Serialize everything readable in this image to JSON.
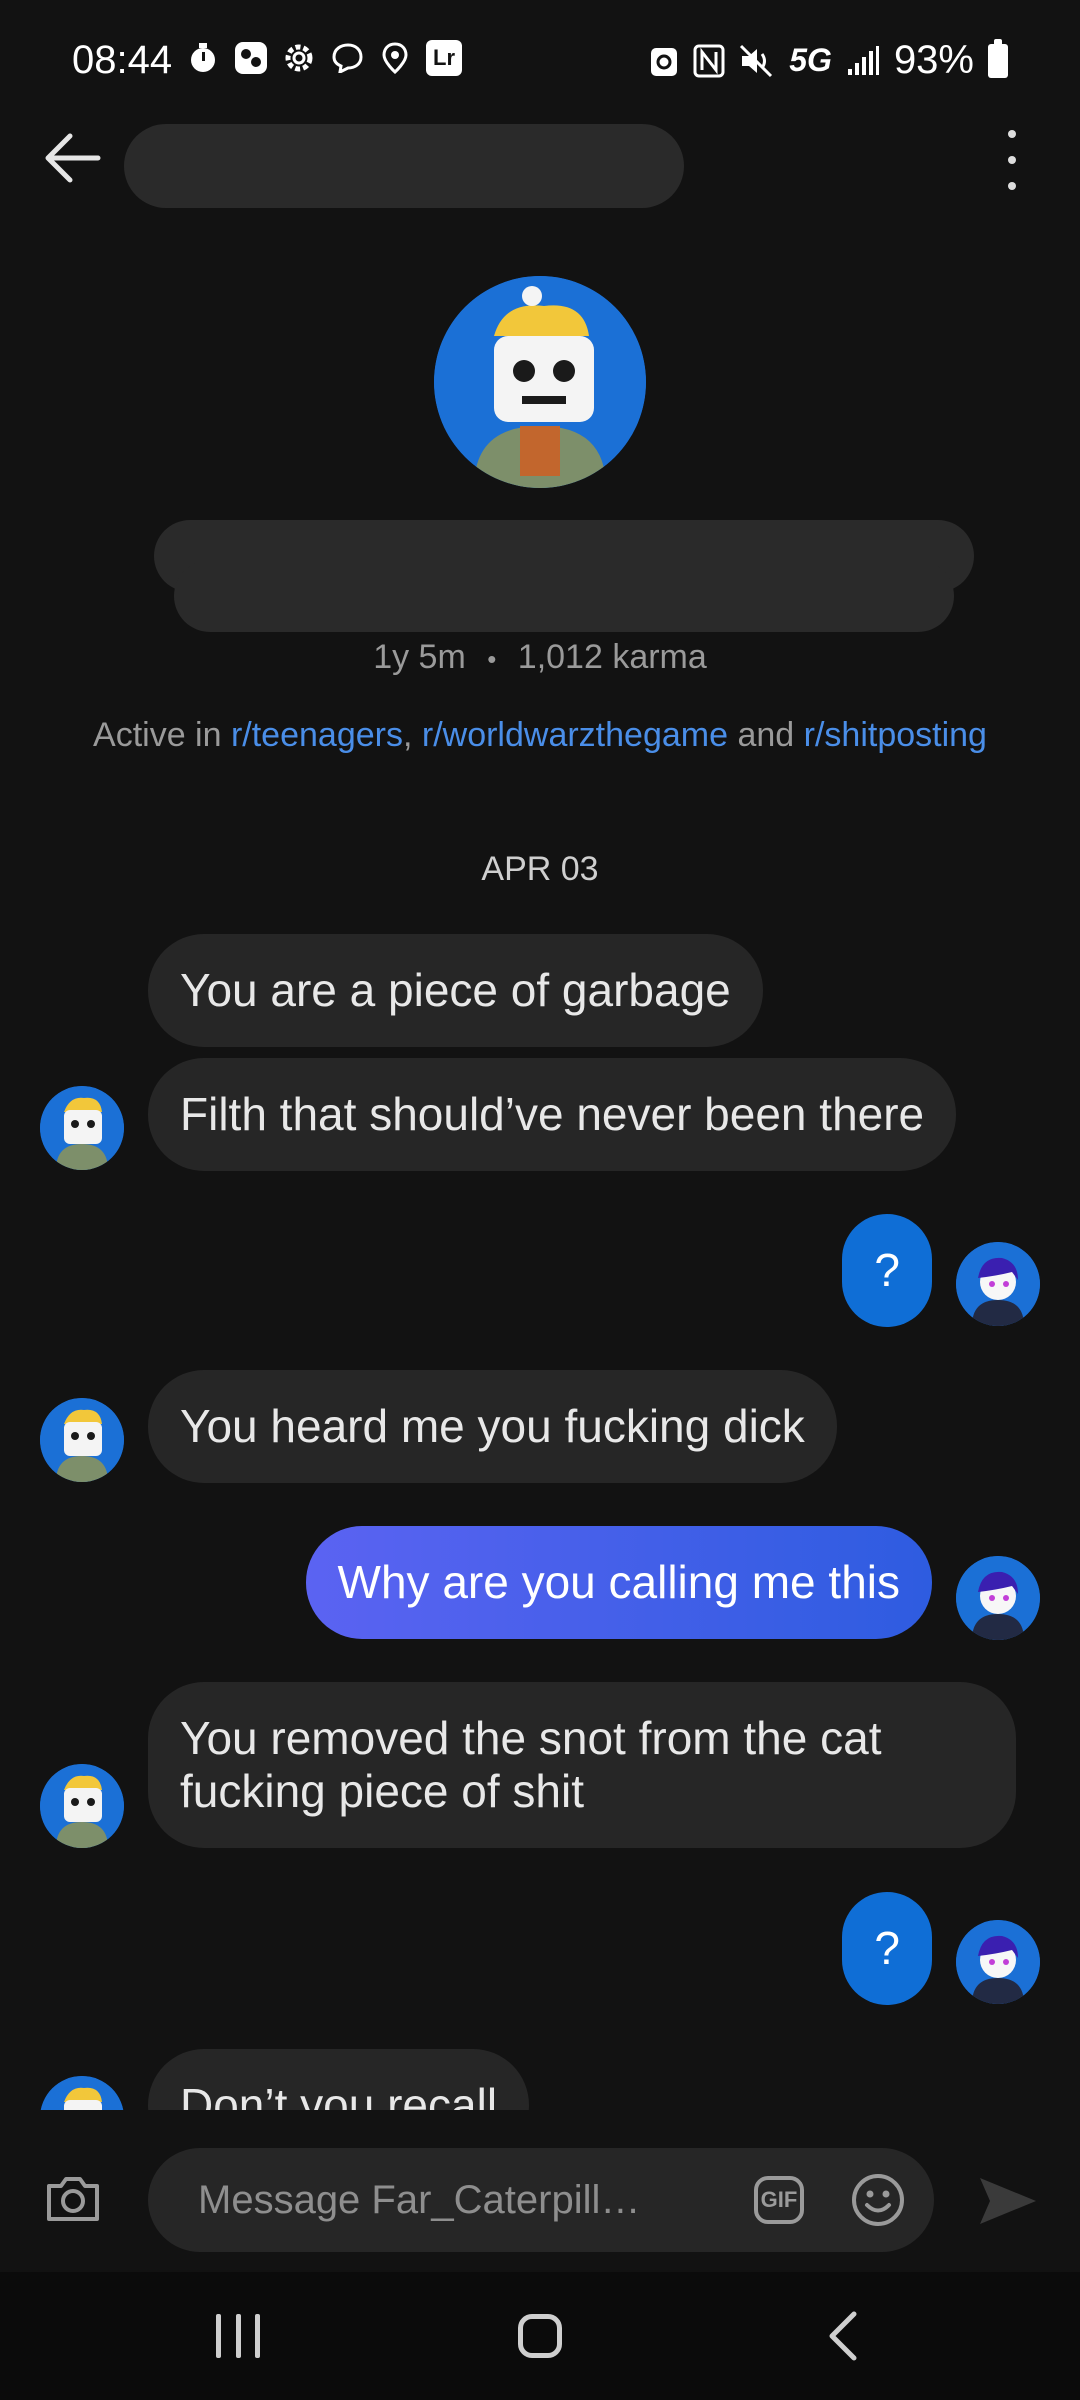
{
  "status_bar": {
    "time": "08:44",
    "network": "5G",
    "battery": "93%",
    "left_icons": [
      "timer-icon",
      "app-icon",
      "settings-icon",
      "messenger-icon",
      "location-icon",
      "lightroom-icon"
    ],
    "lr_label": "Lr"
  },
  "profile": {
    "age": "1y 5m",
    "separator": "•",
    "karma": "1,012 karma",
    "active_prefix": "Active in",
    "communities": [
      "r/teenagers",
      "r/worldwarzthegame",
      "r/shitposting"
    ],
    "comma": ",",
    "and": "and"
  },
  "conversation": {
    "date": "APR 03",
    "messages": [
      {
        "side": "in",
        "text": "You are a piece of garbage"
      },
      {
        "side": "in",
        "text": "Filth that should’ve never been there"
      },
      {
        "side": "out",
        "text": "?"
      },
      {
        "side": "in",
        "text": "You heard me you fucking dick"
      },
      {
        "side": "out",
        "text": "Why are you calling me this"
      },
      {
        "side": "in",
        "text": "You removed the snot from the cat fucking piece of shit"
      },
      {
        "side": "out",
        "text": "?"
      },
      {
        "side": "in",
        "text": "Don’t you recall"
      }
    ]
  },
  "composer": {
    "placeholder": "Message Far_Caterpill…",
    "gif_label": "GIF"
  },
  "colors": {
    "background": "#121212",
    "incoming_bubble": "#262626",
    "outgoing_bubble": "#0f6ed6",
    "link": "#4a8ee8"
  }
}
